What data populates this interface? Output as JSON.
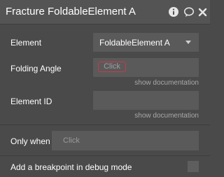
{
  "header": {
    "title": "Fracture FoldableElement A",
    "icons": [
      "info-icon",
      "comment-icon",
      "close-icon"
    ]
  },
  "fields": {
    "element": {
      "label": "Element",
      "value": "FoldableElement A"
    },
    "folding_angle": {
      "label": "Folding Angle",
      "placeholder": "Click",
      "doc_link": "show documentation"
    },
    "element_id": {
      "label": "Element ID",
      "value": "",
      "doc_link": "show documentation"
    }
  },
  "conditions": {
    "only_when_label": "Only when",
    "only_when_placeholder": "Click",
    "breakpoint_label": "Add a breakpoint in debug mode"
  },
  "colors": {
    "background": "#4a4a4a",
    "header": "#545454",
    "field": "#5a5a5a",
    "accent_border": "#c73a4e"
  }
}
